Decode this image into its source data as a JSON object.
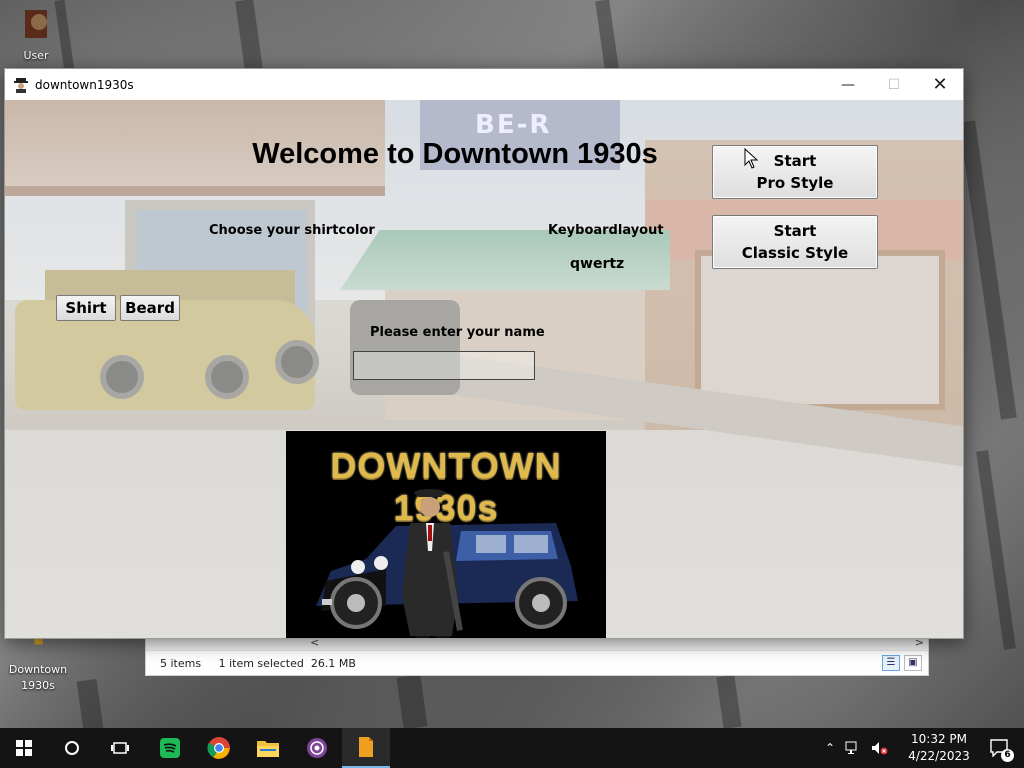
{
  "desktop": {
    "icons": [
      {
        "label": "User"
      },
      {
        "label": "Downtown 1930s"
      }
    ]
  },
  "window": {
    "title": "downtown1930s",
    "controls": {
      "minimize": "—",
      "maximize": "☐",
      "close": "✕"
    }
  },
  "game": {
    "welcome": "Welcome to Downtown 1930s",
    "shirt_color_label": "Choose your shirtcolor",
    "keyboard_label": "Keyboardlayout",
    "keyboard_value": "qwertz",
    "shirt_button": "Shirt",
    "beard_button": "Beard",
    "name_label": "Please enter your name",
    "name_value": "",
    "start_pro": {
      "line1": "Start",
      "line2": "Pro Style"
    },
    "start_classic": {
      "line1": "Start",
      "line2": "Classic Style"
    },
    "poster_title": "DOWNTOWN 1930s",
    "scenery_sign": "BE-R"
  },
  "explorer": {
    "items": "5 items",
    "selected": "1 item selected  26.1 MB",
    "scroll_left": "<",
    "scroll_right": ">"
  },
  "taskbar": {
    "time": "10:32 PM",
    "date": "4/22/2023",
    "notifications": "6"
  },
  "colors": {
    "taskbar": "#141414",
    "poster_gold": "#e0b94a",
    "spotify_green": "#1db954",
    "tor_purple": "#7d4698"
  }
}
